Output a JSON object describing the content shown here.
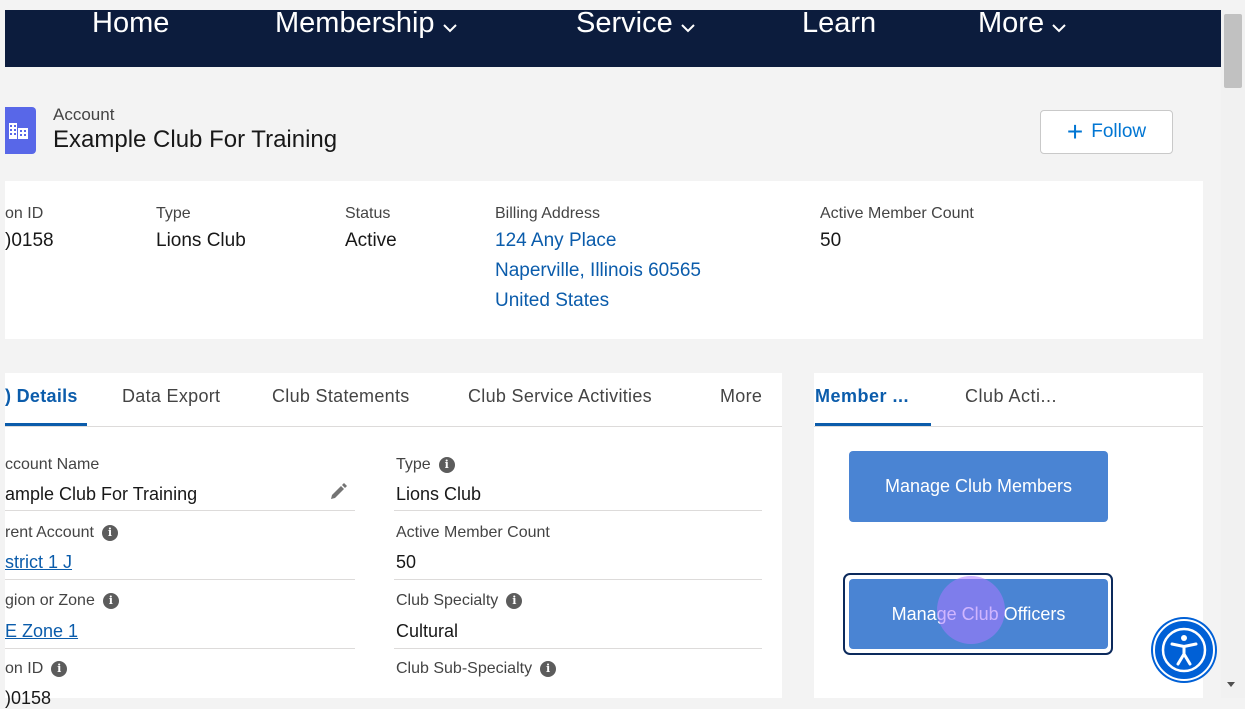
{
  "nav": {
    "items": [
      {
        "label": "Home",
        "has_dropdown": false
      },
      {
        "label": "Membership",
        "has_dropdown": true
      },
      {
        "label": "Service",
        "has_dropdown": true
      },
      {
        "label": "Learn",
        "has_dropdown": false
      },
      {
        "label": "More",
        "has_dropdown": true
      }
    ]
  },
  "header": {
    "object_label": "Account",
    "title": "Example Club For Training",
    "follow_label": "Follow",
    "icon": "account-building-icon"
  },
  "highlights": {
    "fields": [
      {
        "label": "on ID",
        "value": ")0158"
      },
      {
        "label": "Type",
        "value": "Lions Club"
      },
      {
        "label": "Status",
        "value": "Active"
      },
      {
        "label": "Billing Address",
        "lines": [
          "124 Any Place",
          "Naperville, Illinois 60565",
          "United States"
        ]
      },
      {
        "label": "Active Member Count",
        "value": "50"
      }
    ]
  },
  "tabs": {
    "items": [
      "Details",
      "Data Export",
      "Club Statements",
      "Club Service Activities",
      "More"
    ],
    "active_prefix": ")",
    "active_index": 0
  },
  "details": {
    "left": [
      {
        "label": "ccount Name",
        "value": "ample Club For Training",
        "editable": true
      },
      {
        "label": "rent Account",
        "value": "strict 1 J",
        "link": true,
        "info": true
      },
      {
        "label": "gion or Zone",
        "value": "E Zone 1",
        "link": true,
        "info": true
      },
      {
        "label": "on ID",
        "value": ")0158",
        "info": true
      }
    ],
    "right": [
      {
        "label": "Type",
        "value": "Lions Club",
        "info": true
      },
      {
        "label": "Active Member Count",
        "value": "50"
      },
      {
        "label": "Club Specialty",
        "value": "Cultural",
        "info": true
      },
      {
        "label": "Club Sub-Specialty",
        "value": "",
        "info": true
      }
    ]
  },
  "side_panel": {
    "tabs": [
      "Member ...",
      "Club Acti..."
    ],
    "active_index": 0,
    "buttons": [
      "Manage Club Members",
      "Manage Club Officers"
    ]
  },
  "accessibility": {
    "icon": "accessibility-icon"
  },
  "colors": {
    "nav_bg": "#0c1c3d",
    "link": "#0b5cab",
    "button_blue": "#4a84d3",
    "account_icon": "#5867e8",
    "a11y_blue": "#0060d6"
  }
}
